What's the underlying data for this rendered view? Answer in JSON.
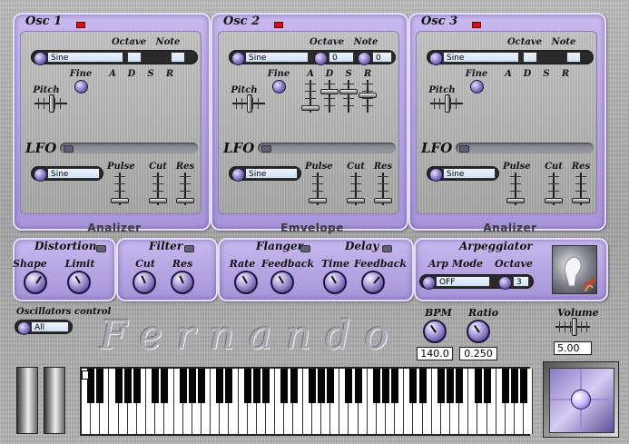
{
  "oscillators": [
    {
      "title": "Osc 1",
      "waveform": "Sine",
      "octave_label": "Octave",
      "note_label": "Note",
      "octave_value": "",
      "note_value": "",
      "fine_label": "Fine",
      "pitch_label": "Pitch",
      "adsr": [
        "A",
        "D",
        "S",
        "R"
      ],
      "lfo_label": "LFO",
      "lfo_waveform": "Sine",
      "lfo_sliders": [
        "Pulse",
        "Cut",
        "Res"
      ],
      "footer": "Analizer"
    },
    {
      "title": "Osc 2",
      "waveform": "Sine",
      "octave_label": "Octave",
      "note_label": "Note",
      "octave_value": "0",
      "note_value": "0",
      "fine_label": "Fine",
      "pitch_label": "Pitch",
      "adsr": [
        "A",
        "D",
        "S",
        "R"
      ],
      "lfo_label": "LFO",
      "lfo_waveform": "Sine",
      "lfo_sliders": [
        "Pulse",
        "Cut",
        "Res"
      ],
      "footer": "Emvelope"
    },
    {
      "title": "Osc 3",
      "waveform": "Sine",
      "octave_label": "Octave",
      "note_label": "Note",
      "octave_value": "",
      "note_value": "",
      "fine_label": "Fine",
      "pitch_label": "Pitch",
      "adsr": [
        "A",
        "D",
        "S",
        "R"
      ],
      "lfo_label": "LFO",
      "lfo_waveform": "Sine",
      "lfo_sliders": [
        "Pulse",
        "Cut",
        "Res"
      ],
      "footer": "Analizer"
    }
  ],
  "effects": {
    "distortion": {
      "title": "Distortion",
      "shape": "Shape",
      "limit": "Limit"
    },
    "filter": {
      "title": "Filter",
      "cut": "Cut",
      "res": "Res"
    },
    "flanger": {
      "title": "Flanger",
      "rate": "Rate",
      "feedback": "Feedback"
    },
    "delay": {
      "title": "Delay",
      "time": "Time",
      "feedback": "Feedback"
    },
    "arpeggiator": {
      "title": "Arpeggiator",
      "mode_label": "Arp Mode",
      "mode_value": "OFF",
      "octave_label": "Octave",
      "octave_value": "3"
    }
  },
  "bottom": {
    "osc_control_label": "Oscillators control",
    "osc_control_value": "All",
    "app_title": "Fernando",
    "bpm_label": "BPM",
    "bpm_value": "140.0",
    "ratio_label": "Ratio",
    "ratio_value": "0.250",
    "volume_label": "Volume",
    "volume_value": "5.00"
  },
  "colors": {
    "panel": "#b8a6e6",
    "led": "#d0101a",
    "knob": "#8f80c8"
  }
}
